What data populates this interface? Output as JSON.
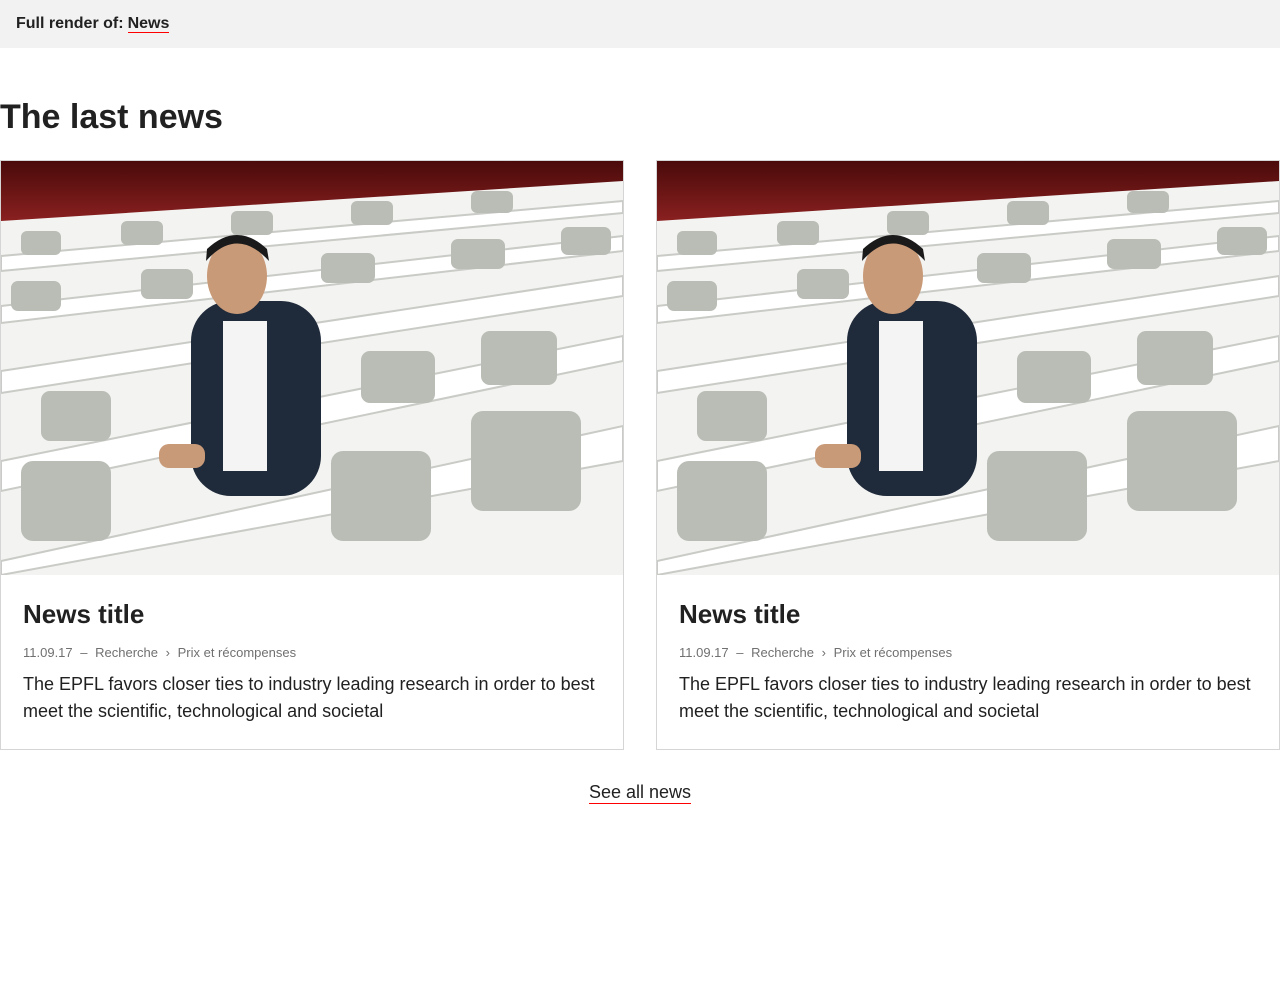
{
  "topbar": {
    "prefix": "Full render of:",
    "link": "News"
  },
  "section": {
    "title": "The last news"
  },
  "cards": [
    {
      "title": "News title",
      "date": "11.09.17",
      "sep": "–",
      "category": "Recherche",
      "chevron": "›",
      "subcategory": "Prix et récompenses",
      "excerpt": "The EPFL favors closer ties to industry leading research in order to best meet the scientific, technological and societal"
    },
    {
      "title": "News title",
      "date": "11.09.17",
      "sep": "–",
      "category": "Recherche",
      "chevron": "›",
      "subcategory": "Prix et récompenses",
      "excerpt": "The EPFL favors closer ties to industry leading research in order to best meet the scientific, technological and societal"
    }
  ],
  "see_all": "See all news",
  "colors": {
    "accent": "#ff0000",
    "topbar_bg": "#f2f2f3",
    "text": "#212121",
    "meta": "#707070"
  }
}
